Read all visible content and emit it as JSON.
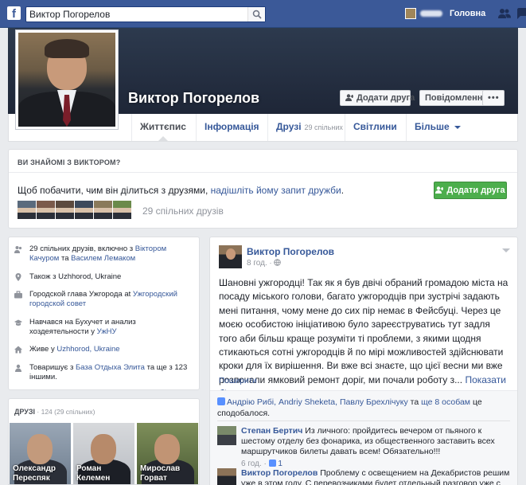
{
  "topbar": {
    "logo": "f",
    "search_value": "Виктор Погорелов",
    "home_label": "Головна"
  },
  "profile": {
    "name": "Виктор Погорелов",
    "add_friend_label": "Додати друга",
    "message_label": "Повідомлення",
    "more_label": "•••"
  },
  "tabs": [
    {
      "label": "Життєпис"
    },
    {
      "label": "Інформація"
    },
    {
      "label": "Друзі",
      "count": "29 спільних"
    },
    {
      "label": "Світлини"
    },
    {
      "label": "Більше"
    }
  ],
  "know_card": {
    "title": "ВИ ЗНАЙОМІ З ВИКТОРОМ?",
    "text_before": "Щоб побачити, чим він ділиться з друзями, ",
    "text_link": "надішліть йому запит дружби",
    "text_after": ".",
    "button_label": "Додати друга",
    "mutual_count": "29 спільних друзів",
    "thumb_colors": [
      "#5a6b7d",
      "#7b5a4a",
      "#5c4a3e",
      "#3d4a5c",
      "#8a7a5a",
      "#6a8a4a"
    ]
  },
  "intro": {
    "rows": [
      {
        "icon": "people-icon",
        "parts": [
          "29 спільних друзів, включно з ",
          "Віктором Качуром",
          " та ",
          "Василем Лемаком",
          ""
        ]
      },
      {
        "icon": "location-icon",
        "parts": [
          "Також з Uzhhorod, Ukraine"
        ]
      },
      {
        "icon": "briefcase-icon",
        "parts": [
          "Городской глава Ужгорода at ",
          "Ужгородский городской совет",
          ""
        ]
      },
      {
        "icon": "graduation-icon",
        "parts": [
          "Навчався на Бухучет и анализ хоздеятельности у ",
          "УжНУ",
          ""
        ]
      },
      {
        "icon": "home-icon",
        "parts": [
          "Живе у ",
          "Uzhhorod, Ukraine",
          ""
        ]
      },
      {
        "icon": "school-icon",
        "parts": [
          "Товаришує з ",
          "База Отдыха Элита",
          " та ще з 123 іншими."
        ]
      }
    ]
  },
  "friends": {
    "title": "ДРУЗІ",
    "count": " · 124 (29 спільних)",
    "tiles": [
      {
        "name_line1": "Олександр",
        "name_line2": "Переспяк"
      },
      {
        "name_line1": "Роман Келемен",
        "name_line2": ""
      },
      {
        "name_line1": "Мирослав",
        "name_line2": "Горват"
      }
    ]
  },
  "post": {
    "author": "Виктор Погорелов",
    "time": "8 год.",
    "text": "Шановні ужгородці! Так як я був двічі обраний громадою міста на посаду міського голови, багато ужгородців при зустрічі задають мені питання, чому мене до сих пір немає в Фейсбуці. Через це моєю особистою ініціативою було зареєструватись тут задля того аби більш краще розуміти ті проблеми, з якими щодня стикаються сотні ужгородців й по мірі можливостей здійснювати кроки для їх вирішення. Ви вже всі знаєте, що цієї весни ми вже розпочали ямковий ремонт доріг, ми почали роботу з...",
    "show_more": "Показати більше...",
    "share_label": "Поширити",
    "likes_names": "Андрію Рибі, Andriy Sheketa, Павлу Брехлічуку",
    "likes_and": " та ",
    "likes_others": "ще 8 особам",
    "likes_suffix": " це сподобалося.",
    "comments": [
      {
        "author": "Степан Бертич",
        "text": " Из личного: пройдитесь вечером от пьяного к шестому отделу без фонарика, из общественного заставить всех маршрутчиков билеты давать всем! Обязательно!!!",
        "time": "6 год.",
        "likes": "1"
      },
      {
        "author": "Виктор Погорелов",
        "text": " Проблему с освещением на Декабристов решим уже в этом году. С перевозчиками будет отдельный разговор уже с первых"
      }
    ]
  }
}
